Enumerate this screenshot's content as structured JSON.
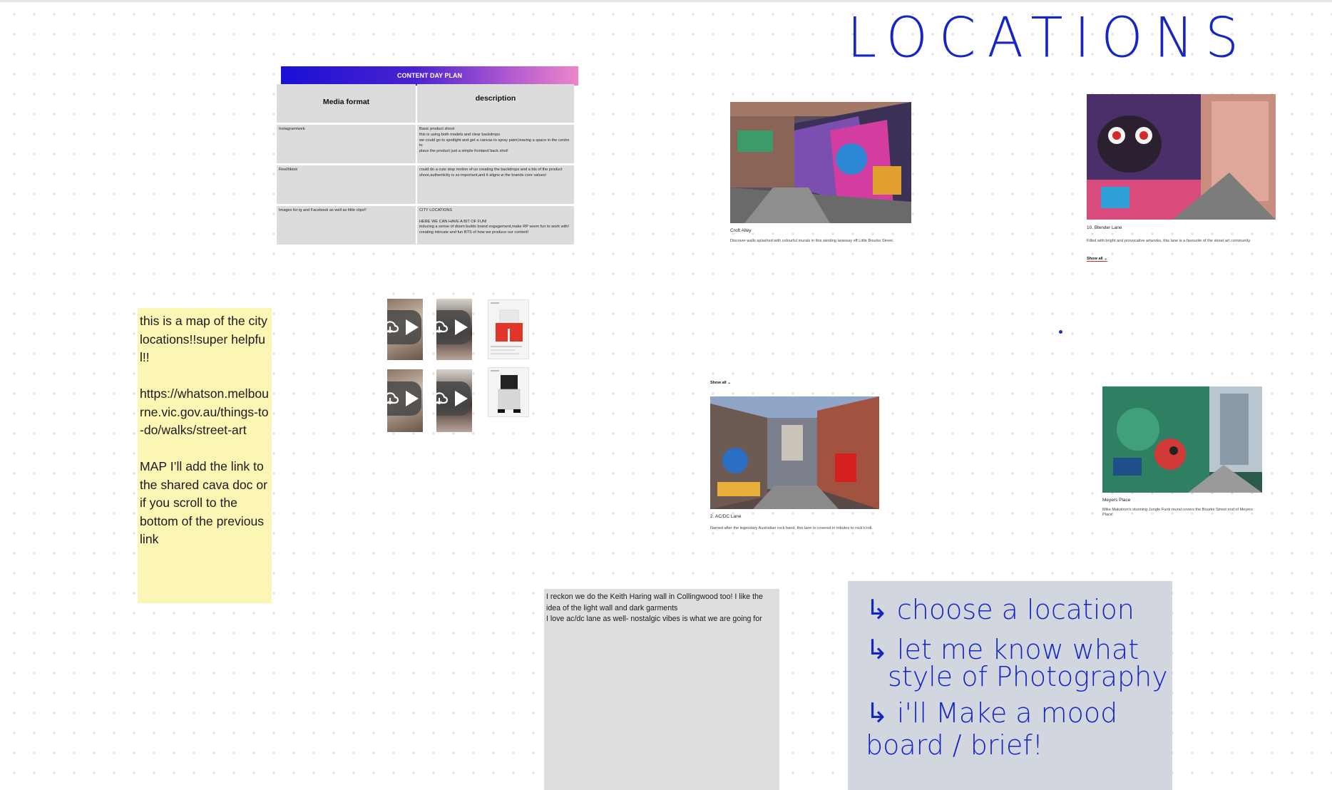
{
  "board": {
    "title_handwriting": "LOCATIONS"
  },
  "content_plan": {
    "title": "CONTENT DAY PLAN",
    "col1_header": "Media format",
    "col2_header": "description",
    "rows": [
      {
        "format": "Instagram/web",
        "desc_lines": [
          "Basic product shoot",
          "this is using both models and clear backdrops",
          "we could go to spotlight and get a canvas to spray paint,leaving a space in the centre to",
          "place the product just a simple frontand back shot!"
        ]
      },
      {
        "format": "Reel/tiktok",
        "desc_lines": [
          "could do a cute stop motion of us creating the backdrops and a bts of the product",
          "shoot,authenticity is so important,and it aligns w the brands core values!"
        ]
      },
      {
        "format": "Images for ig and Facebook as well as little clips!!",
        "desc_lines": [
          "CITY LOCATIONS",
          "",
          "HERE WE CAN HAVE A BIT OF FUN!",
          "inducing a sense of doom builds brand engagement,make RP seem fun to work with!",
          "creating intricate and fun BTS of how we produce our content!"
        ]
      }
    ]
  },
  "yellow_note": {
    "p1": "this is a map of the city locations!!super helpful!!",
    "p2": "https://whatson.melbourne.vic.gov.au/things-to-do/walks/street-art",
    "p3": "MAP I’ll add the link to the shared cava doc or if you scroll to the bottom of the previous link"
  },
  "grey_note": {
    "p1": "I reckon we do the Keith Haring wall in Collingwood too! I like the idea of the light wall and dark garments",
    "p2": "I love ac/dc lane as well- nostalgic vibes is what we are going for"
  },
  "blue_note": {
    "lines": [
      "↳ choose a location",
      "↳ let me know what",
      "style of Photography",
      "↳ i'll Make a mood",
      "board / brief!"
    ]
  },
  "locations": [
    {
      "name": "Croft Alley",
      "description": "Discover walls splashed with colourful murals in this winding laneway off Little Bourke Street."
    },
    {
      "name": "10. Blender Lane",
      "description": "Filled with bright and provocative artworks, this lane is a favourite of the street art community.",
      "show_all": "Show all ⌄"
    },
    {
      "name": "2. AC/DC Lane",
      "description": "Named after the legendary Australian rock band, this lane is covered in tributes to rock'n'roll.",
      "show_all": "Show all ⌄"
    },
    {
      "name": "Meyers Place",
      "description": "Mike Makatron's stunning Jungle Funk mural covers the Bourke Street end of Meyers Place."
    }
  ],
  "icons": {
    "video": "cloud-play-icon",
    "play": "play-icon"
  },
  "colors": {
    "handwriting": "#1626c4",
    "yellow_note": "#fcf6b5",
    "grey_note": "#dedede",
    "blue_note": "#d2d6df",
    "plan_header_start": "#1a10d6",
    "plan_header_end": "#ec86c8"
  }
}
